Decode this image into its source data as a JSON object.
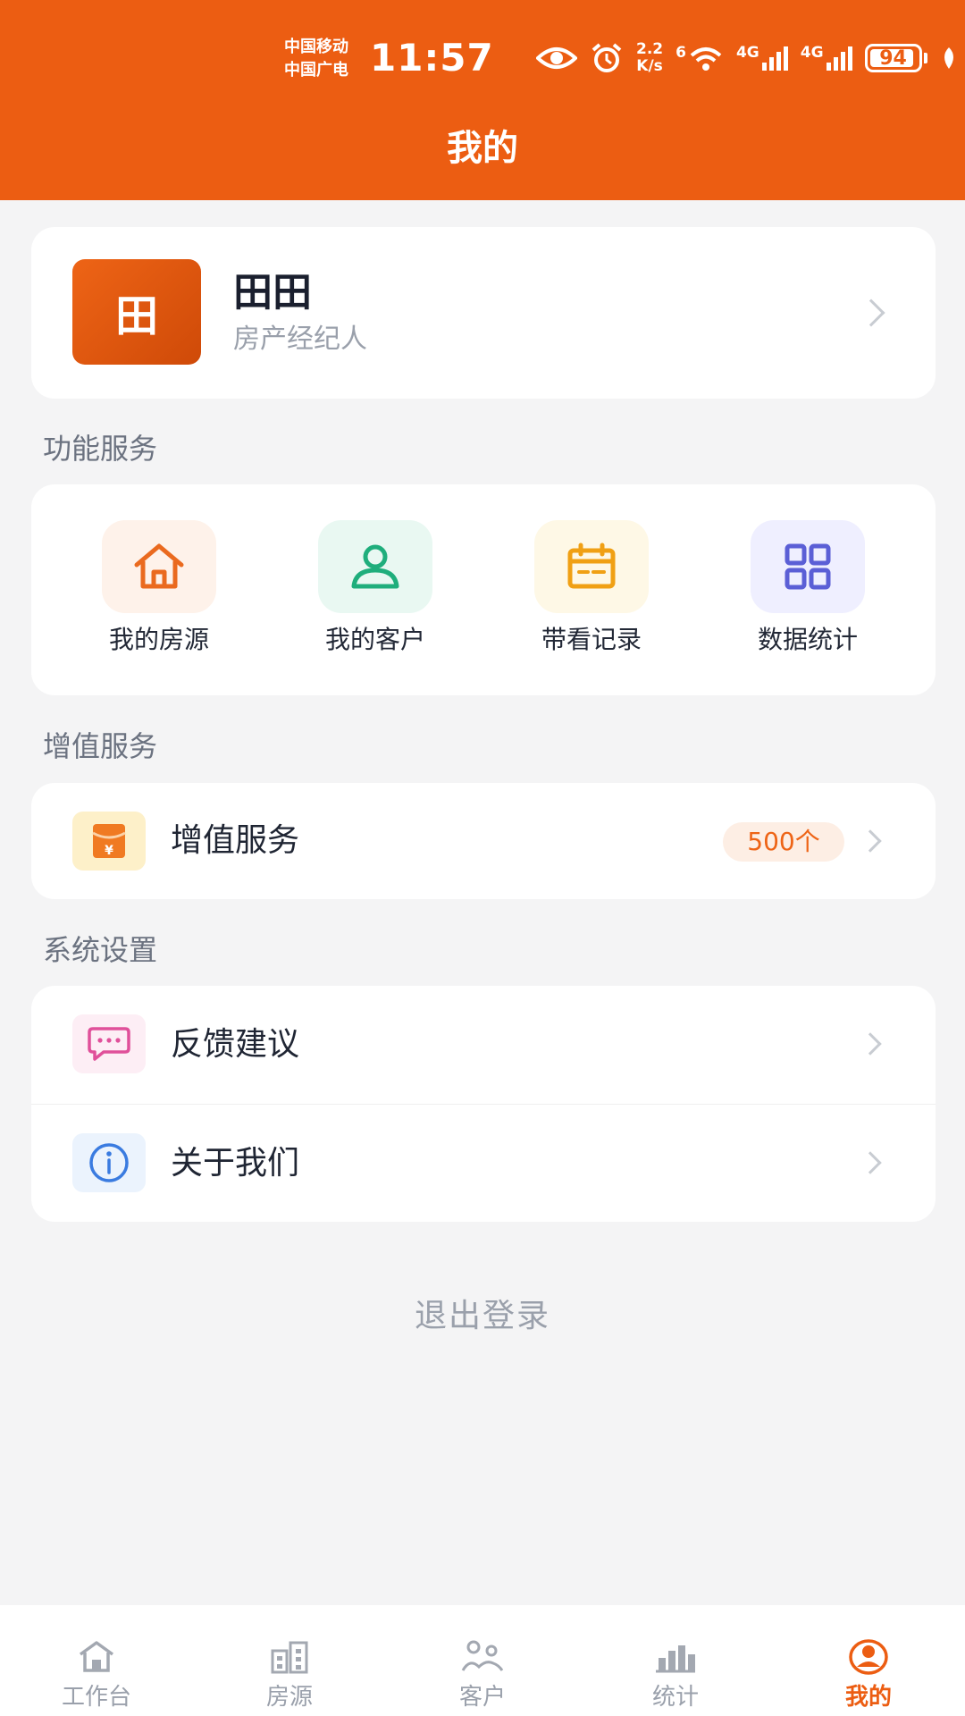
{
  "status_bar": {
    "carrier1": "中国移动",
    "carrier2": "中国广电",
    "time": "11:57",
    "speed_value": "2.2",
    "speed_unit": "K/s",
    "wifi_label": "6",
    "net1_label": "4G",
    "net2_label": "4G",
    "battery": "94",
    "battery_level": 0.94
  },
  "header": {
    "title": "我的"
  },
  "profile": {
    "avatar_text": "田",
    "name": "田田",
    "role": "房产经纪人"
  },
  "sections": {
    "functions_title": "功能服务",
    "value_added_title": "增值服务",
    "settings_title": "系统设置"
  },
  "functions": [
    {
      "label": "我的房源",
      "icon": "house-icon",
      "bg": "#fef2ea",
      "color": "#ea6a1f"
    },
    {
      "label": "我的客户",
      "icon": "user-icon",
      "bg": "#e9f8f2",
      "color": "#1fae7c"
    },
    {
      "label": "带看记录",
      "icon": "calendar-icon",
      "bg": "#fef8e6",
      "color": "#f0a014"
    },
    {
      "label": "数据统计",
      "icon": "grid-icon",
      "bg": "#efefff",
      "color": "#5b5fd6"
    }
  ],
  "value_added": {
    "label": "增值服务",
    "badge": "500个",
    "icon": "red-envelope-icon"
  },
  "settings": [
    {
      "label": "反馈建议",
      "icon": "chat-bubble-icon"
    },
    {
      "label": "关于我们",
      "icon": "info-icon"
    }
  ],
  "logout_label": "退出登录",
  "tabs": [
    {
      "label": "工作台",
      "icon": "home-icon",
      "active": false
    },
    {
      "label": "房源",
      "icon": "building-icon",
      "active": false
    },
    {
      "label": "客户",
      "icon": "customers-icon",
      "active": false
    },
    {
      "label": "统计",
      "icon": "bar-chart-icon",
      "active": false
    },
    {
      "label": "我的",
      "icon": "profile-icon",
      "active": true
    }
  ],
  "colors": {
    "accent": "#ec5d12",
    "page_bg": "#f4f4f5",
    "muted": "#9aa0ab"
  }
}
